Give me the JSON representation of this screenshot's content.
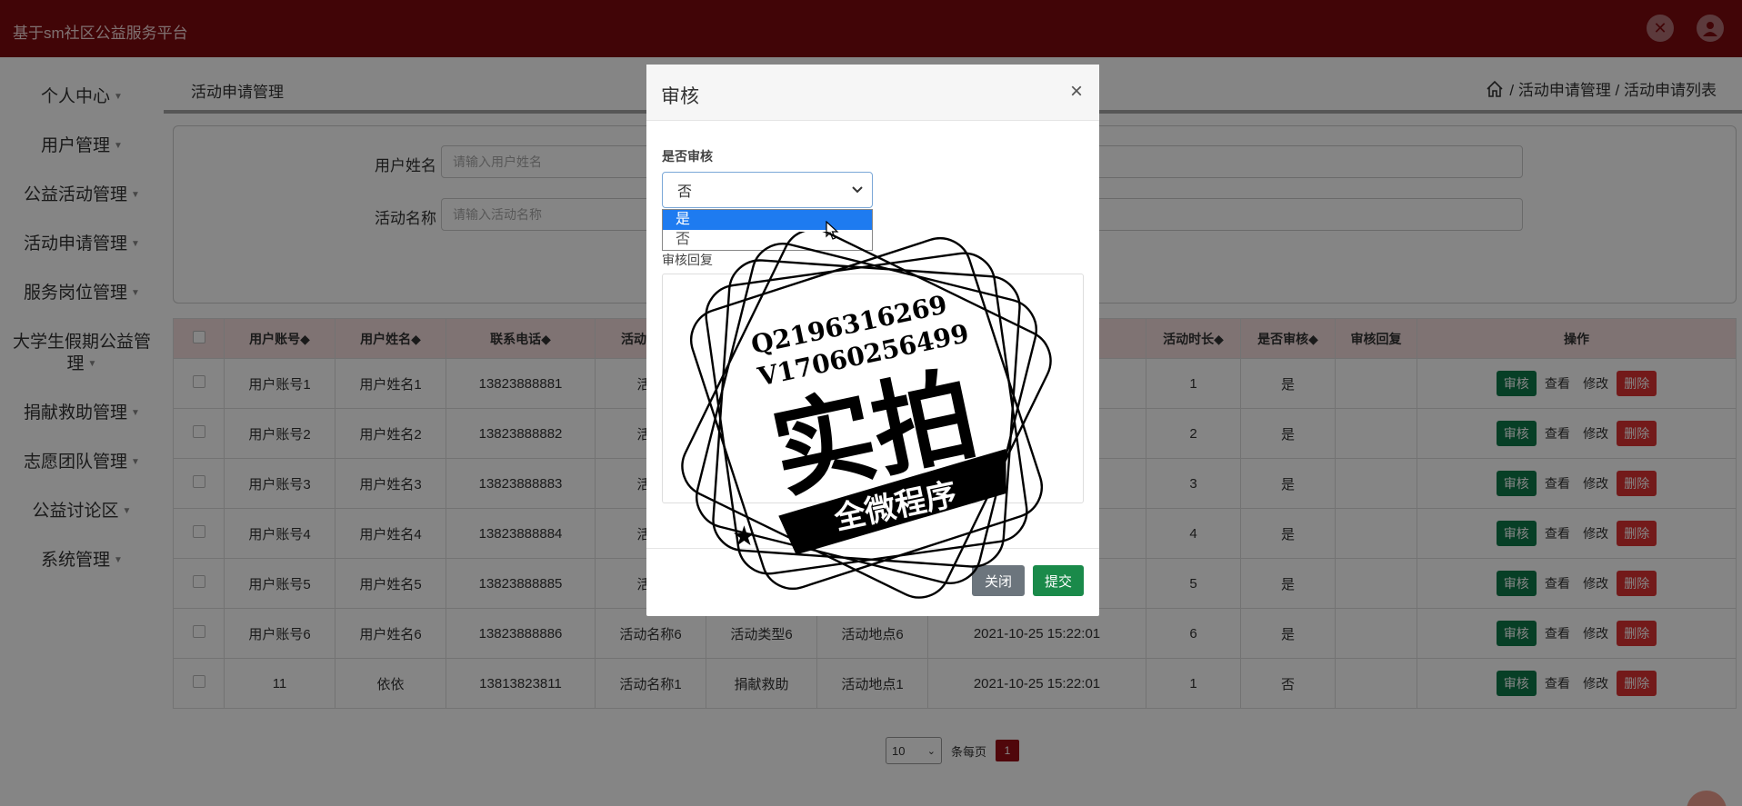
{
  "header": {
    "app_title": "基于sm社区公益服务平台"
  },
  "sidebar": {
    "items": [
      {
        "label": "个人中心"
      },
      {
        "label": "用户管理"
      },
      {
        "label": "公益活动管理"
      },
      {
        "label": "活动申请管理"
      },
      {
        "label": "服务岗位管理"
      },
      {
        "label": "大学生假期公益管",
        "label2": "理"
      },
      {
        "label": "捐献救助管理"
      },
      {
        "label": "志愿团队管理"
      },
      {
        "label": "公益讨论区"
      },
      {
        "label": "系统管理"
      }
    ]
  },
  "breadcrumb": {
    "title": "活动申请管理",
    "path": "/ 活动申请管理 / 活动申请列表"
  },
  "search": {
    "name_label": "用户姓名",
    "name_placeholder": "请输入用户姓名",
    "activity_label": "活动名称",
    "activity_placeholder": "请输入活动名称"
  },
  "table": {
    "columns": [
      "用户账号◆",
      "用户姓名◆",
      "联系电话◆",
      "活动",
      "活动时长◆",
      "是否审核◆",
      "审核回复",
      "操作"
    ],
    "rows": [
      {
        "account": "用户账号1",
        "name": "用户姓名1",
        "phone": "13823888881",
        "activity": "活动",
        "type": "",
        "place": "",
        "time": "",
        "duration": "1",
        "audited": "是"
      },
      {
        "account": "用户账号2",
        "name": "用户姓名2",
        "phone": "13823888882",
        "activity": "活动",
        "type": "",
        "place": "",
        "time": "",
        "duration": "2",
        "audited": "是"
      },
      {
        "account": "用户账号3",
        "name": "用户姓名3",
        "phone": "13823888883",
        "activity": "活动",
        "type": "",
        "place": "",
        "time": "",
        "duration": "3",
        "audited": "是"
      },
      {
        "account": "用户账号4",
        "name": "用户姓名4",
        "phone": "13823888884",
        "activity": "活动",
        "type": "",
        "place": "",
        "time": "",
        "duration": "4",
        "audited": "是"
      },
      {
        "account": "用户账号5",
        "name": "用户姓名5",
        "phone": "13823888885",
        "activity": "活动",
        "type": "",
        "place": "",
        "time": "",
        "duration": "5",
        "audited": "是"
      },
      {
        "account": "用户账号6",
        "name": "用户姓名6",
        "phone": "13823888886",
        "activity": "活动名称6",
        "type": "活动类型6",
        "place": "活动地点6",
        "time": "2021-10-25 15:22:01",
        "duration": "6",
        "audited": "是"
      },
      {
        "account": "11",
        "name": "依依",
        "phone": "13813823811",
        "activity": "活动名称1",
        "type": "捐献救助",
        "place": "活动地点1",
        "time": "2021-10-25 15:22:01",
        "duration": "1",
        "audited": "否"
      }
    ],
    "actions": {
      "audit": "审核",
      "view": "查看",
      "edit": "修改",
      "delete": "删除"
    }
  },
  "pager": {
    "page_size": "10",
    "per_page_label": "条每页",
    "current_page": "1"
  },
  "modal": {
    "title": "审核",
    "close_symbol": "×",
    "audit_label": "是否审核",
    "audit_value": "否",
    "options": [
      "是",
      "否"
    ],
    "reply_label": "审核回复",
    "close_button": "关闭",
    "submit_button": "提交"
  },
  "watermark": {
    "line1": "Q2196316269",
    "line2": "V17060256499",
    "main": "实拍",
    "ribbon": "全微程序"
  },
  "colors": {
    "header": "#7d0a0f",
    "audit_button": "#0e7a4a",
    "delete_button": "#d33333",
    "dropdown_highlight": "#1e7bf0"
  }
}
